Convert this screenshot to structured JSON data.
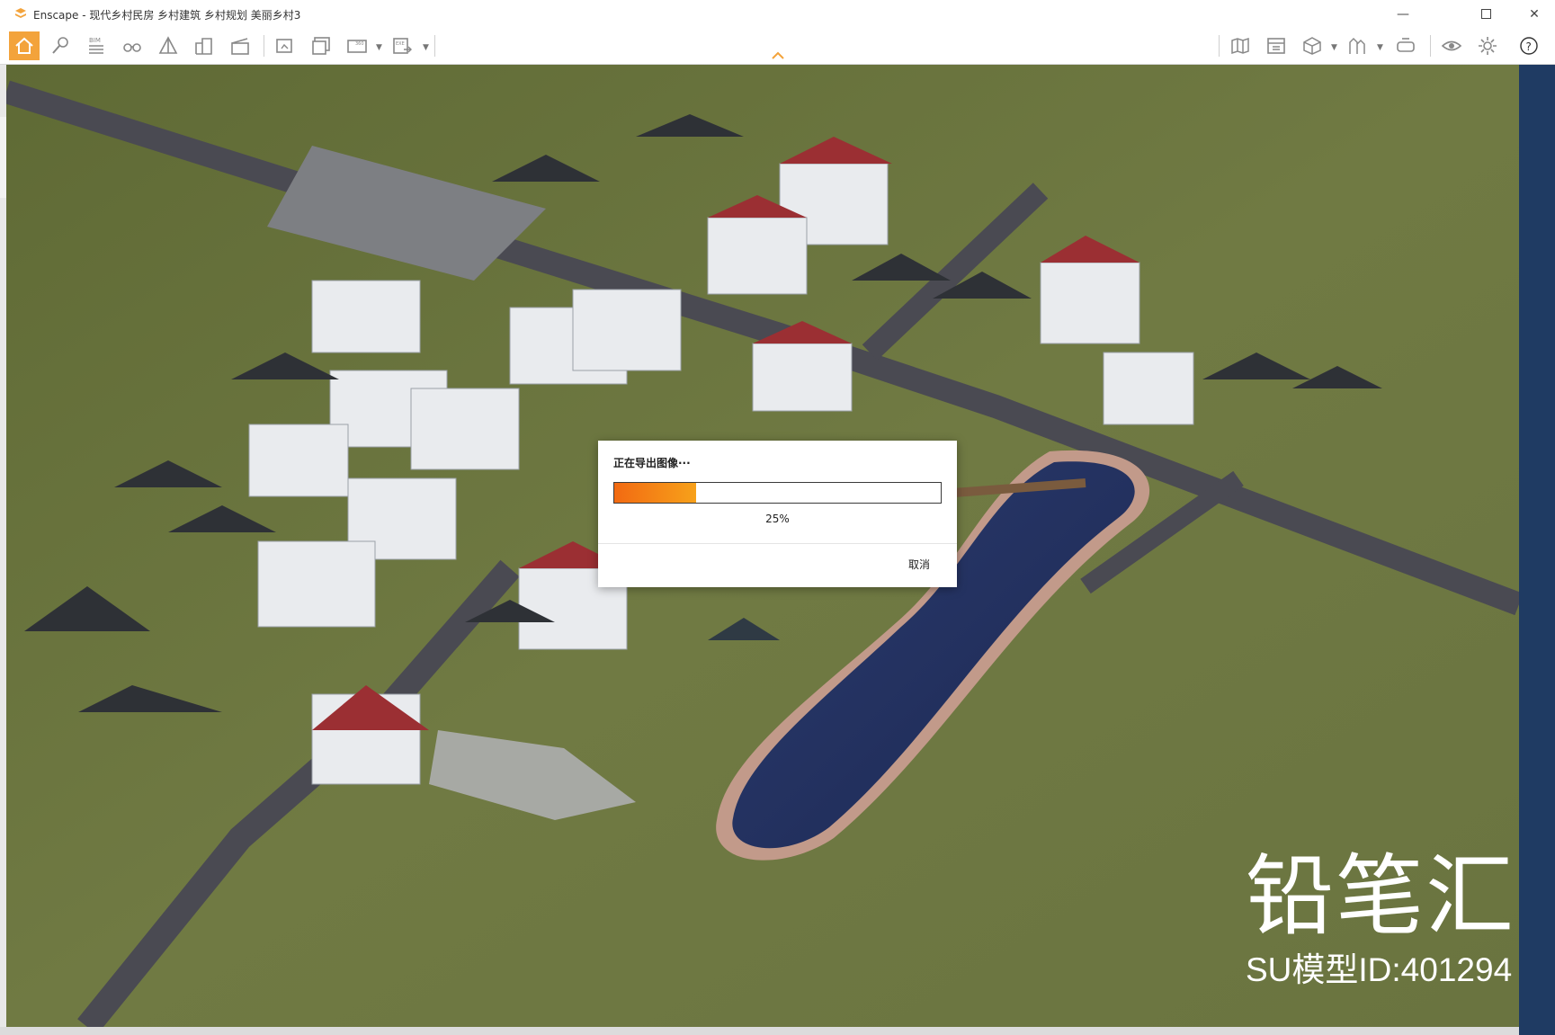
{
  "window": {
    "title": "Enscape - 现代乡村民房 乡村建筑 乡村规划 美丽乡村3",
    "minimize_icon": "minimize-icon",
    "maximize_icon": "maximize-icon",
    "close_icon": "close-icon"
  },
  "toolbar": {
    "bim_label": "BIM",
    "left_icons": [
      "home-icon",
      "walk-mode-icon",
      "bim-icon",
      "binoculars-icon",
      "perspective-icon",
      "buildings-icon",
      "video-editor-icon",
      "screenshot-icon",
      "batch-render-icon",
      "panorama-icon",
      "exe-export-icon"
    ],
    "right_icons": [
      "map-icon",
      "asset-library-icon",
      "view-cube-icon",
      "material-icon",
      "vr-headset-icon",
      "visual-settings-icon",
      "settings-icon",
      "help-icon"
    ]
  },
  "dialog": {
    "title": "正在导出图像···",
    "progress_percent": 25,
    "progress_label": "25%",
    "cancel_label": "取消"
  },
  "watermark": {
    "brand_name": "铅笔汇",
    "model_id": "SU模型ID:401294"
  },
  "colors": {
    "accent_orange": "#f3a33b",
    "progress_start": "#f26a12",
    "progress_end": "#f7a11a",
    "window_frame": "#1f3b63"
  }
}
